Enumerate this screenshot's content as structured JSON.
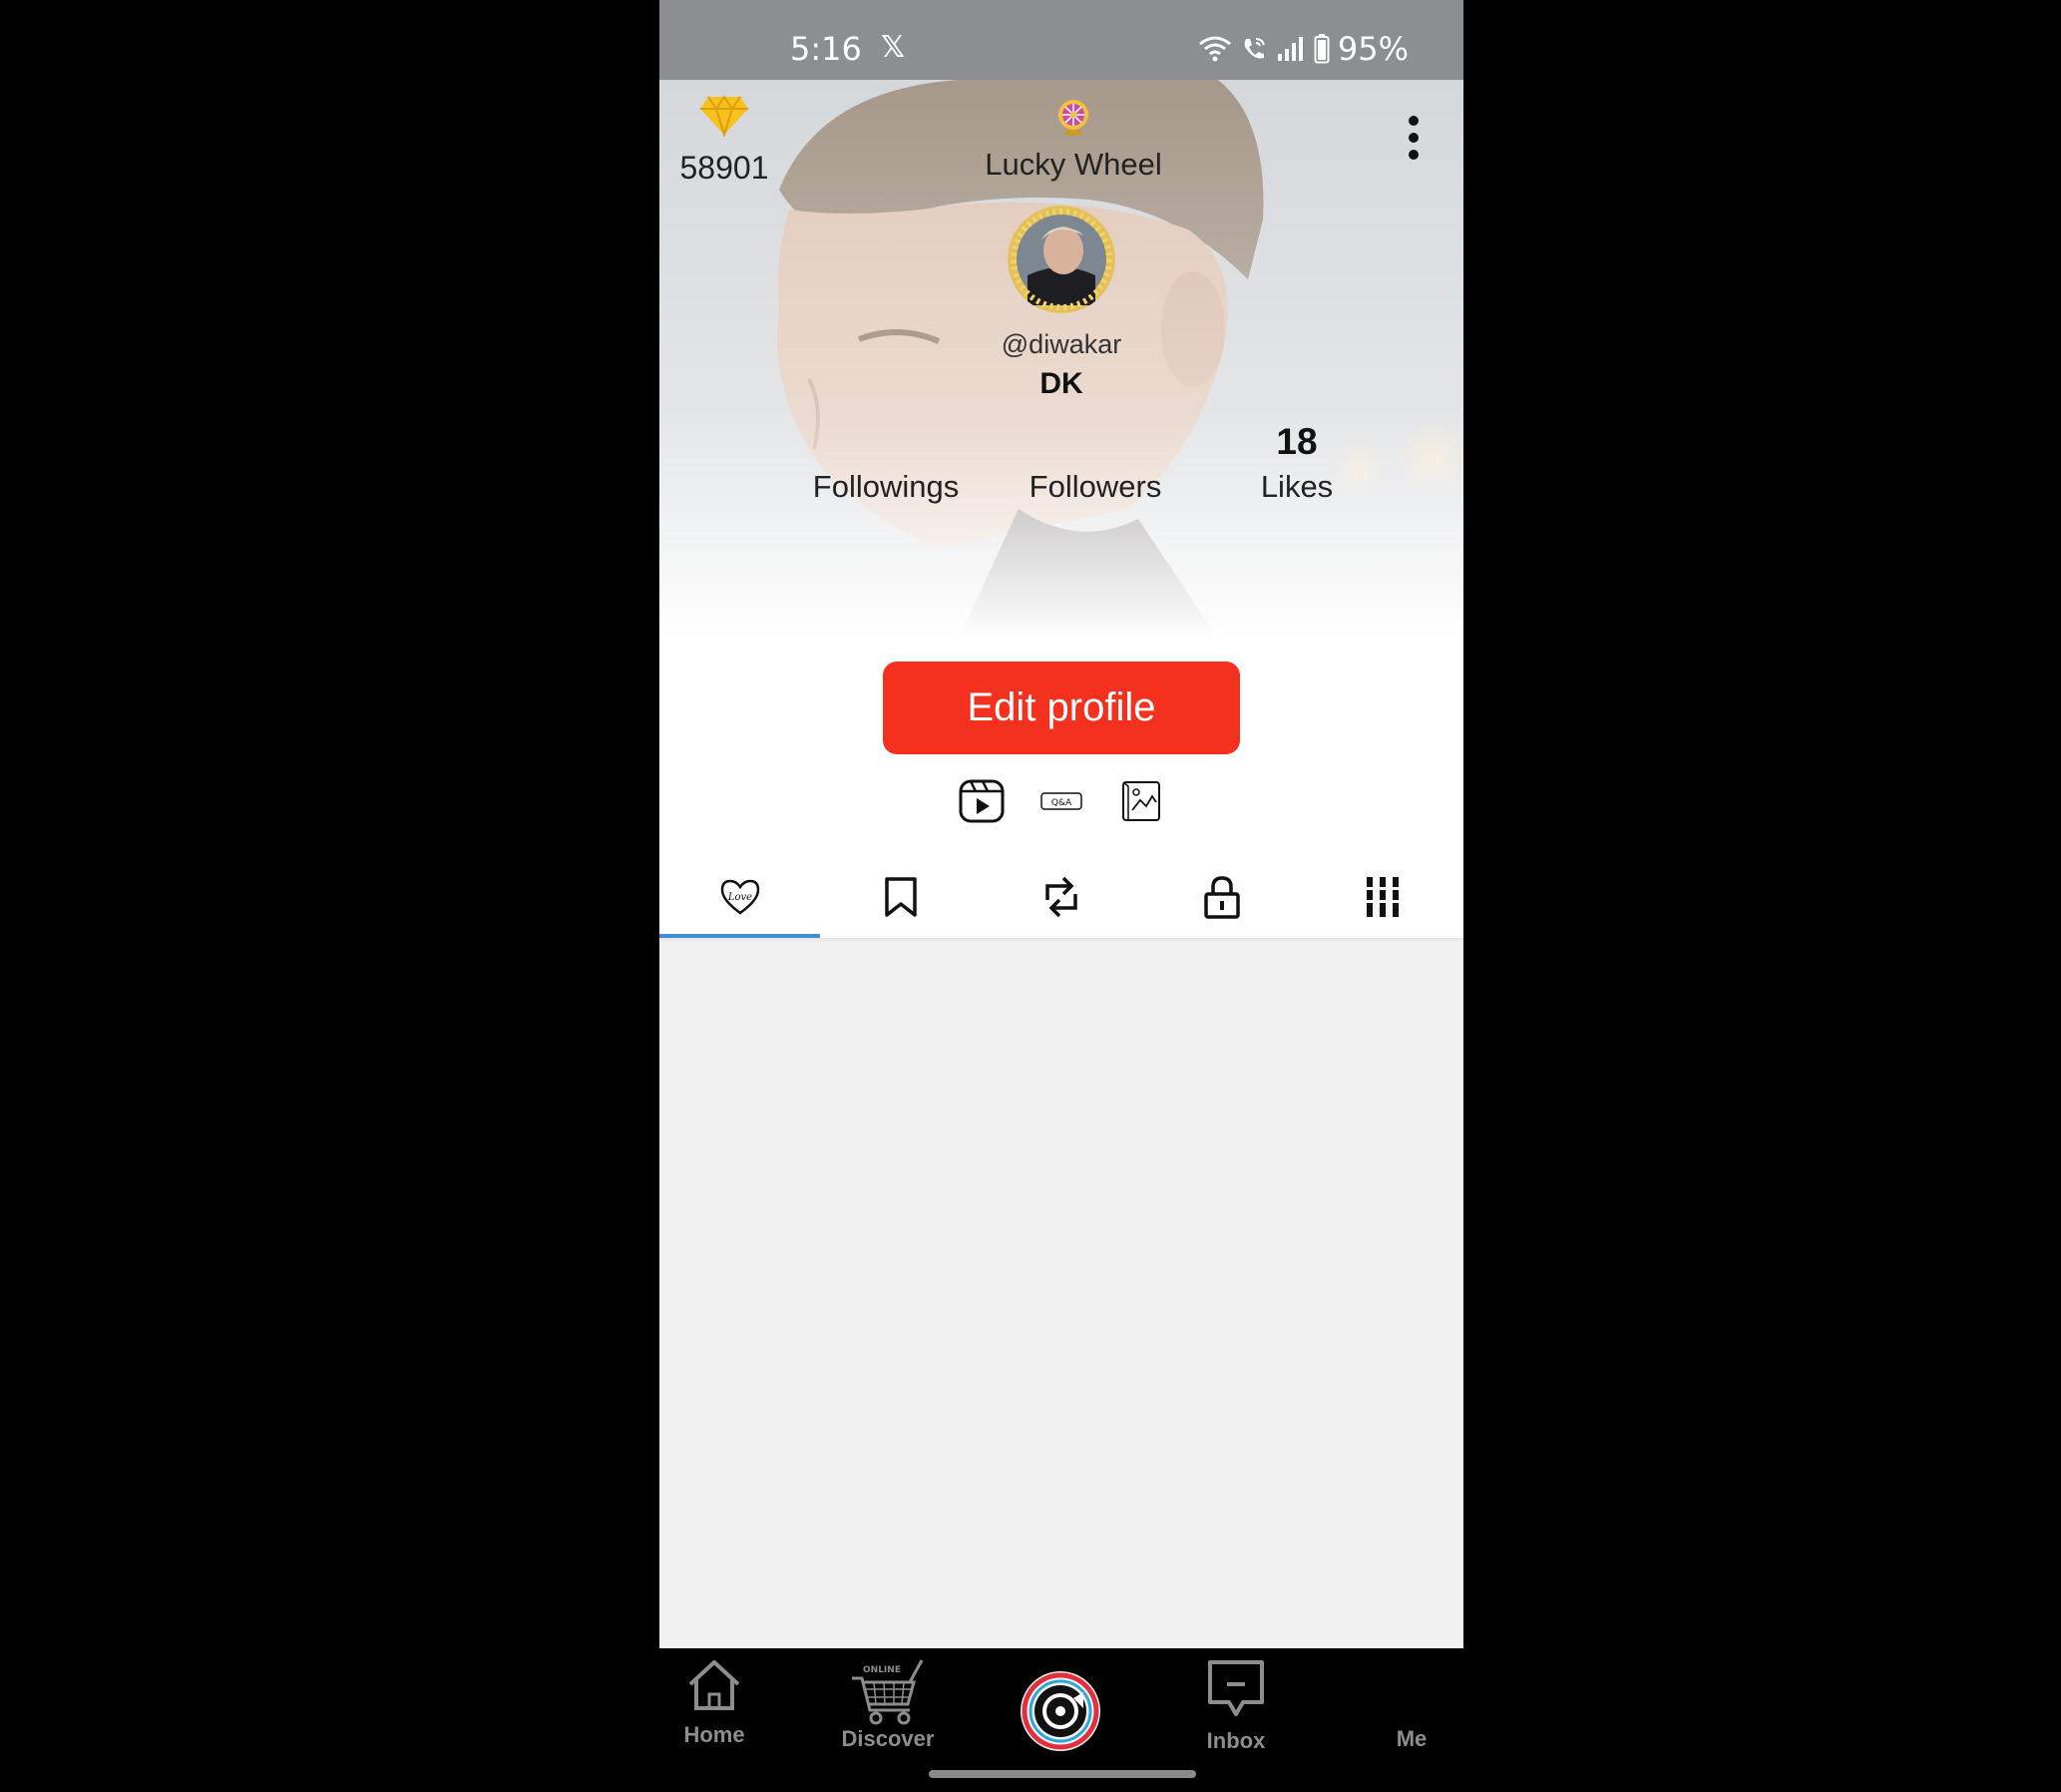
{
  "status_bar": {
    "time": "5:16",
    "notification": "𝕏",
    "battery": "95%"
  },
  "header": {
    "diamond_count": "58901",
    "lucky_wheel_label": "Lucky Wheel",
    "username": "@diwakar",
    "display_name": "DK",
    "stats": {
      "followings_label": "Followings",
      "followings_value": "",
      "followers_label": "Followers",
      "followers_value": "",
      "likes_label": "Likes",
      "likes_value": "18"
    }
  },
  "profile": {
    "edit_label": "Edit profile",
    "edit_color": "#f4301f",
    "content_type_icons": [
      "video-play-icon",
      "qa-icon",
      "photo-album-icon"
    ],
    "tabs": [
      {
        "icon": "love-heart-icon",
        "active": true
      },
      {
        "icon": "bookmark-icon",
        "active": false
      },
      {
        "icon": "repost-icon",
        "active": false
      },
      {
        "icon": "lock-icon",
        "active": false
      },
      {
        "icon": "grid-columns-icon",
        "active": false
      }
    ],
    "active_tab_color": "#3f8fd6"
  },
  "bottom_nav": {
    "home": "Home",
    "discover": "Discover",
    "discover_badge": "ONLINE",
    "inbox": "Inbox",
    "me": "Me"
  }
}
